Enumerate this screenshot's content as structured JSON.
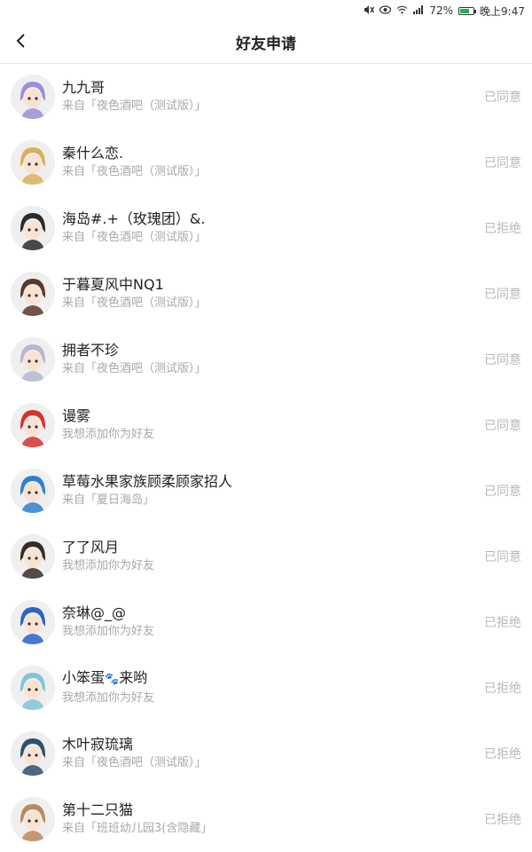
{
  "statusbar": {
    "battery_text": "72%",
    "battery_level": 0.72,
    "time": "晚上9:47",
    "icons": [
      "mute-icon",
      "eye-icon",
      "wifi-icon",
      "signal-icon",
      "battery-icon"
    ]
  },
  "header": {
    "title": "好友申请",
    "back_icon": "chevron-left-icon"
  },
  "requests": [
    {
      "name": "九九哥",
      "source": "来自「夜色酒吧（测试版）」",
      "status": "已同意",
      "avatar_color": "#9b8fd6"
    },
    {
      "name": "秦什么恋.",
      "source": "来自「夜色酒吧（测试版）」",
      "status": "已同意",
      "avatar_color": "#d9b15a"
    },
    {
      "name": "海岛#.+（玫瑰团）&.",
      "source": "来自「夜色酒吧（测试版）」",
      "status": "已拒绝",
      "avatar_color": "#2b2b2b"
    },
    {
      "name": "于暮夏风中NQ1",
      "source": "来自「夜色酒吧（测试版）」",
      "status": "已同意",
      "avatar_color": "#5a3a2a"
    },
    {
      "name": "拥者不珍",
      "source": "来自「夜色酒吧（测试版）」",
      "status": "已同意",
      "avatar_color": "#b6b9c9"
    },
    {
      "name": "谩雾",
      "source": "我想添加你为好友",
      "status": "已同意",
      "avatar_color": "#d6332f"
    },
    {
      "name": "草莓水果家族顾柔顾家招人",
      "source": "来自「夏日海岛」",
      "status": "已同意",
      "avatar_color": "#2f7fd1"
    },
    {
      "name": "了了风月",
      "source": "我想添加你为好友",
      "status": "已同意",
      "avatar_color": "#3a2b24"
    },
    {
      "name": "奈琳@_@",
      "source": "我想添加你为好友",
      "status": "已拒绝",
      "avatar_color": "#2d63c8"
    },
    {
      "name": "小笨蛋",
      "name_suffix": "来哟",
      "source": "我想添加你为好友",
      "status": "已拒绝",
      "avatar_color": "#7fc6d8"
    },
    {
      "name": "木叶寂琉璃",
      "source": "来自「夜色酒吧（测试版）」",
      "status": "已拒绝",
      "avatar_color": "#2e4f6e"
    },
    {
      "name": "第十二只猫",
      "source": "来自「班班幼儿园3(含隐藏」",
      "status": "已拒绝",
      "avatar_color": "#b98a5f"
    }
  ]
}
